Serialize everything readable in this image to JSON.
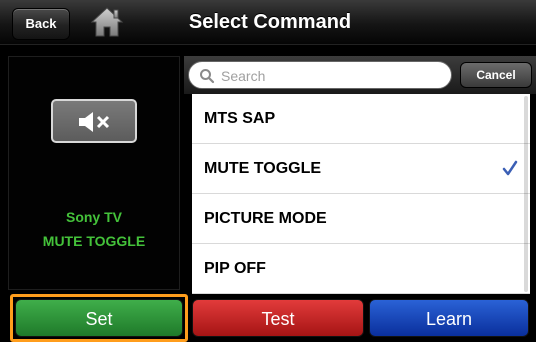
{
  "header": {
    "back_label": "Back",
    "title": "Select Command",
    "home_icon": "home-icon"
  },
  "device_panel": {
    "icon": "mute-speaker-icon",
    "device_name": "Sony TV",
    "command_name": "MUTE TOGGLE"
  },
  "search": {
    "placeholder": "Search",
    "value": "",
    "cancel_label": "Cancel"
  },
  "commands": [
    {
      "label": "MTS SAP",
      "selected": false
    },
    {
      "label": "MUTE TOGGLE",
      "selected": true
    },
    {
      "label": "PICTURE MODE",
      "selected": false
    },
    {
      "label": "PIP OFF",
      "selected": false
    }
  ],
  "actions": {
    "set_label": "Set",
    "test_label": "Test",
    "learn_label": "Learn"
  },
  "colors": {
    "accent_check": "#3b5fb5",
    "device_text": "#44c23a",
    "focus_ring": "#ff9d1c"
  }
}
